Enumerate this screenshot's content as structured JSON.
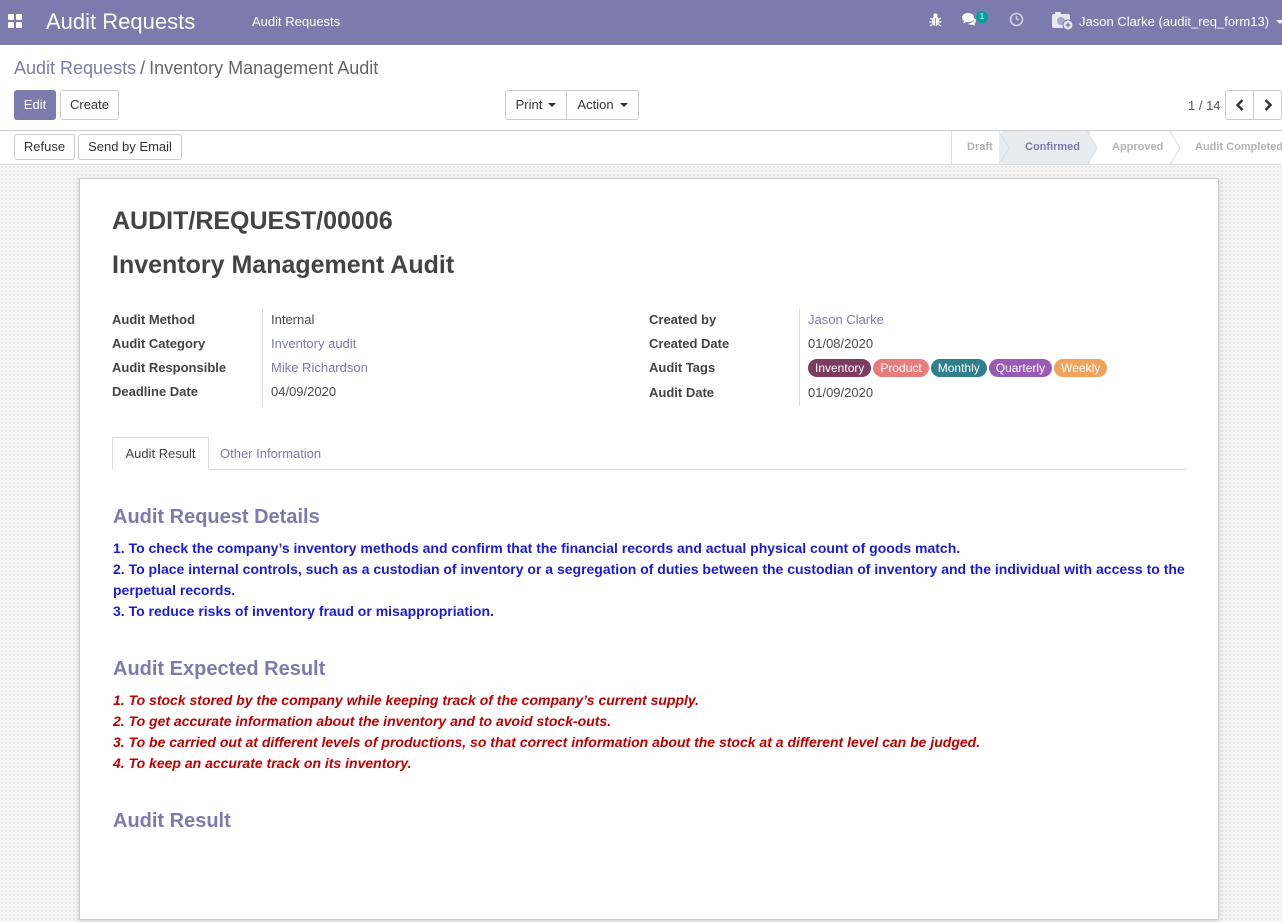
{
  "navbar": {
    "app_title": "Audit Requests",
    "menu_item": "Audit Requests",
    "chat_count": "1",
    "user": "Jason Clarke (audit_req_form13)",
    "icons": [
      "apps-icon",
      "bug-icon",
      "chat-icon",
      "clock-icon",
      "avatar-icon"
    ]
  },
  "breadcrumb": {
    "parent": "Audit Requests",
    "separator": "/",
    "current": "Inventory Management Audit"
  },
  "toolbar": {
    "edit_label": "Edit",
    "create_label": "Create",
    "print_label": "Print",
    "action_label": "Action",
    "pager": "1 / 14"
  },
  "statusbar": {
    "refuse_label": "Refuse",
    "email_label": "Send by Email",
    "stages": [
      "Draft",
      "Confirmed",
      "Approved",
      "Audit Completed"
    ],
    "active_stage": "Confirmed"
  },
  "record": {
    "reference": "AUDIT/REQUEST/00006",
    "name": "Inventory Management Audit"
  },
  "fields_left": [
    {
      "label": "Audit Method",
      "value": "Internal"
    },
    {
      "label": "Audit Category",
      "value": "Inventory audit"
    },
    {
      "label": "Audit Responsible",
      "value": "Mike Richardson"
    },
    {
      "label": "Deadline Date",
      "value": "04/09/2020"
    }
  ],
  "fields_right": [
    {
      "label": "Created by",
      "value": "Jason Clarke"
    },
    {
      "label": "Created Date",
      "value": "01/08/2020"
    },
    {
      "label": "Audit Tags",
      "value": ""
    },
    {
      "label": "Audit Date",
      "value": "01/09/2020"
    }
  ],
  "tags": [
    {
      "label": "Inventory",
      "color": "#7d3c5f"
    },
    {
      "label": "Product",
      "color": "#e67c7c"
    },
    {
      "label": "Monthly",
      "color": "#2f7f8c"
    },
    {
      "label": "Quarterly",
      "color": "#9b59b6"
    },
    {
      "label": "Weekly",
      "color": "#f0a35a"
    }
  ],
  "tabs": [
    "Audit Result",
    "Other Information"
  ],
  "details": {
    "heading": "Audit Request Details",
    "lines": [
      "1. To check the company’s inventory methods and confirm that the financial records and actual physical count of goods match.",
      "2. To place internal controls, such as a custodian of inventory or a segregation of duties between the custodian of inventory and the individual with access to the perpetual records.",
      "3. To reduce risks of inventory fraud or misappropriation."
    ],
    "color": "#1a1adc"
  },
  "expected": {
    "heading": "Audit Expected Result",
    "lines": [
      "1. To stock stored by the company while keeping track of the company’s current supply.",
      "2. To get accurate information about the inventory and to avoid stock-outs.",
      "3. To be carried out at different levels of productions, so that correct information about the stock at a different level can be judged.",
      "4. To keep an accurate track on its inventory."
    ],
    "color": "#c00000"
  },
  "result": {
    "heading": "Audit Result"
  },
  "colors": {
    "brand": "#7c7bad"
  }
}
